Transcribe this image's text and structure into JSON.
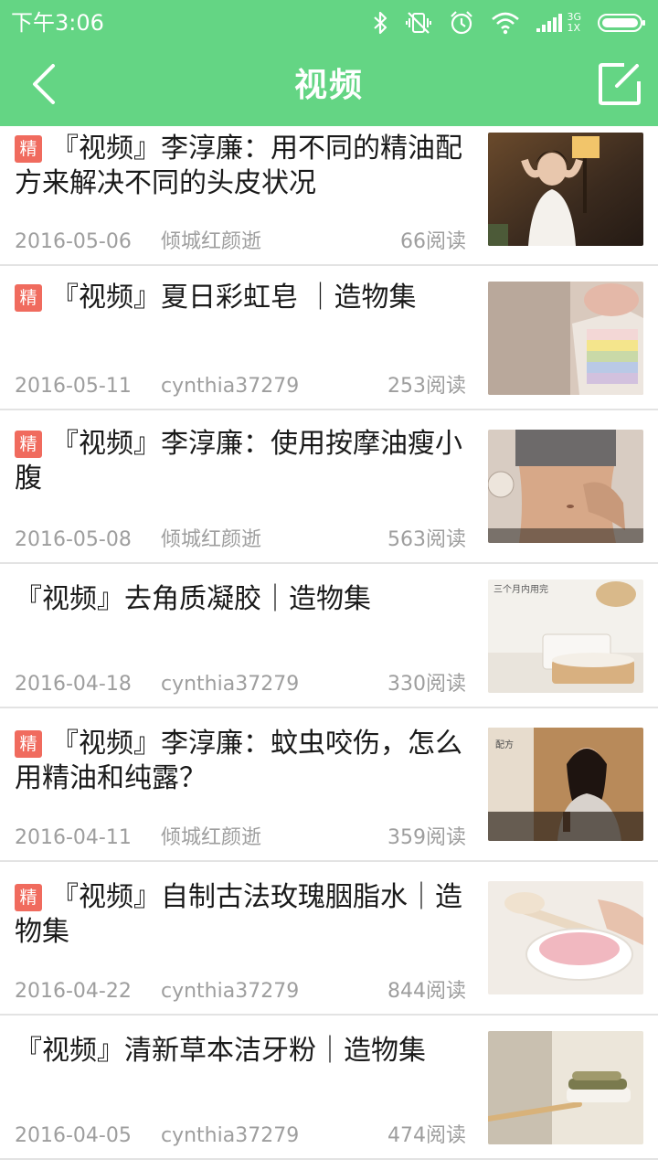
{
  "status_bar": {
    "time": "下午3:06",
    "network_label": "3G",
    "network_sub": "1X",
    "icons": [
      "bluetooth-icon",
      "vibrate-off-icon",
      "alarm-icon",
      "wifi-icon",
      "signal-icon",
      "battery-icon"
    ]
  },
  "header": {
    "title": "视频",
    "back_icon": "back-chevron-icon",
    "edit_icon": "edit-compose-icon",
    "background": "#64d584"
  },
  "badge_label": "精",
  "badge_color": "#f06b5e",
  "articles": [
    {
      "featured": true,
      "title": "『视频』李淳廉：用不同的精油配方来解决不同的头皮状况",
      "date": "2016-05-06",
      "author": "倾城红颜逝",
      "reads": "66阅读",
      "thumb_caption": ""
    },
    {
      "featured": true,
      "title": "『视频』夏日彩虹皂 ｜造物集",
      "date": "2016-05-11",
      "author": "cynthia37279",
      "reads": "253阅读",
      "thumb_caption": ""
    },
    {
      "featured": true,
      "title": "『视频』李淳廉：使用按摩油瘦小腹",
      "date": "2016-05-08",
      "author": "倾城红颜逝",
      "reads": "563阅读",
      "thumb_caption": ""
    },
    {
      "featured": false,
      "title": "『视频』去角质凝胶｜造物集",
      "date": "2016-04-18",
      "author": "cynthia37279",
      "reads": "330阅读",
      "thumb_caption": "三个月内用完"
    },
    {
      "featured": true,
      "title": "『视频』李淳廉：蚊虫咬伤，怎么用精油和纯露？",
      "date": "2016-04-11",
      "author": "倾城红颜逝",
      "reads": "359阅读",
      "thumb_caption": "配方"
    },
    {
      "featured": true,
      "title": "『视频』自制古法玫瑰胭脂水｜造物集",
      "date": "2016-04-22",
      "author": "cynthia37279",
      "reads": "844阅读",
      "thumb_caption": ""
    },
    {
      "featured": false,
      "title": "『视频』清新草本洁牙粉｜造物集",
      "date": "2016-04-05",
      "author": "cynthia37279",
      "reads": "474阅读",
      "thumb_caption": ""
    }
  ]
}
